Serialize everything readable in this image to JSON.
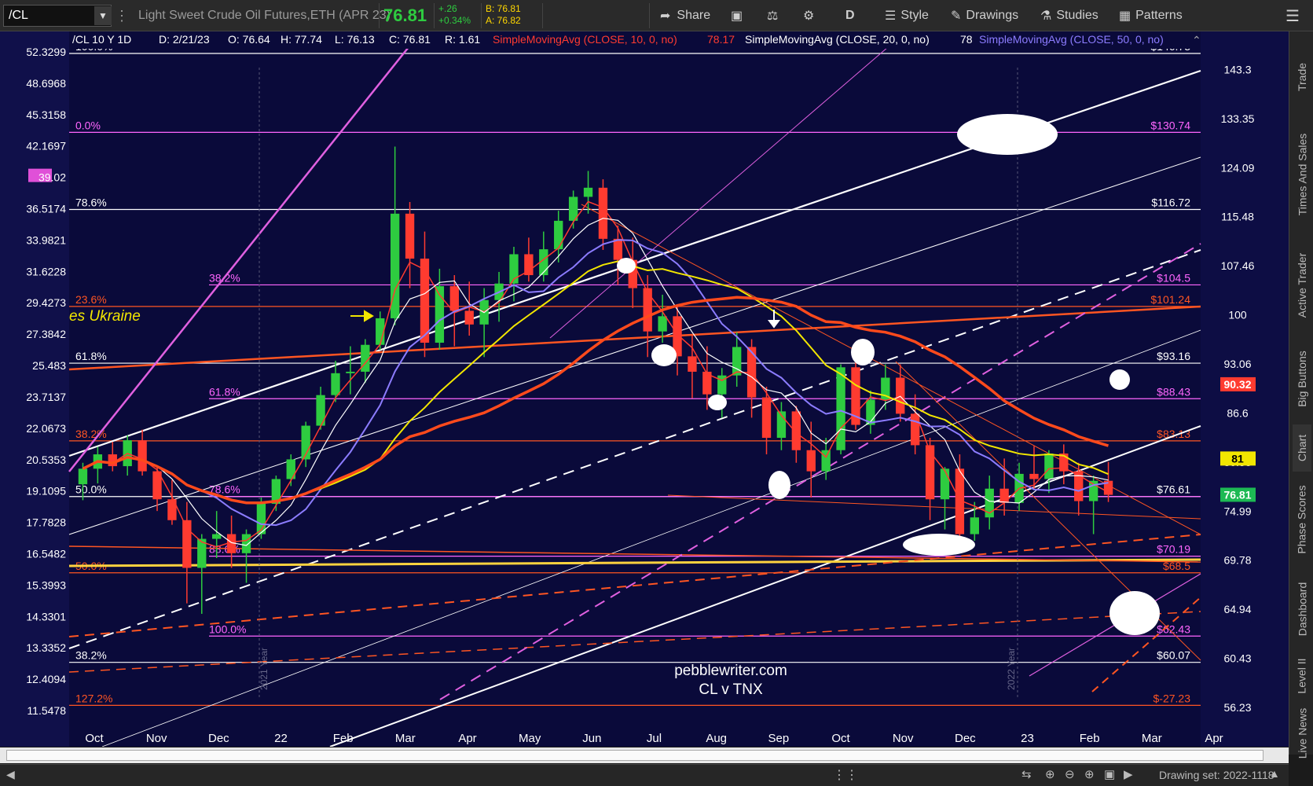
{
  "toolbar": {
    "symbol": "/CL",
    "description": "Light Sweet Crude Oil Futures,ETH (APR 23)",
    "last": "76.81",
    "change": "+.26",
    "change_pct": "+0.34%",
    "bid": "B: 76.81",
    "ask": "A: 76.82",
    "share": "Share",
    "period": "D",
    "style": "Style",
    "drawings": "Drawings",
    "studies": "Studies",
    "patterns": "Patterns"
  },
  "info_bar": {
    "title": "/CL 10 Y 1D",
    "date": "D: 2/21/23",
    "open": "O: 76.64",
    "high": "H: 77.74",
    "low": "L: 76.13",
    "close": "C: 76.81",
    "range": "R: 1.61",
    "sma10": "SimpleMovingAvg (CLOSE, 10, 0, no)",
    "sma10_val": "78.17",
    "sma20": "SimpleMovingAvg (CLOSE, 20, 0, no)",
    "sma20_val": "78",
    "sma50": "SimpleMovingAvg (CLOSE, 50, 0, no)"
  },
  "right_tabs": [
    "Trade",
    "Times And Sales",
    "Active Trader",
    "Big Buttons",
    "Chart",
    "Phase Scores",
    "Dashboard",
    "Level II",
    "Live News"
  ],
  "bottom": {
    "drawing_set": "Drawing set: 2022-1118"
  },
  "chart_data": {
    "type": "candlestick",
    "x_labels": [
      "Oct",
      "Nov",
      "Dec",
      "22",
      "Feb",
      "Mar",
      "Apr",
      "May",
      "Jun",
      "Jul",
      "Aug",
      "Sep",
      "Oct",
      "Nov",
      "Dec",
      "23",
      "Feb",
      "Mar",
      "Apr"
    ],
    "right_axis_labels": [
      "143.3",
      "133.35",
      "124.09",
      "115.48",
      "107.46",
      "100",
      "93.06",
      "86.6",
      "80.58",
      "74.99",
      "69.78",
      "64.94",
      "60.43",
      "56.23"
    ],
    "left_axis_labels": [
      "52.3299",
      "48.6968",
      "45.3158",
      "42.1697",
      "39.02",
      "36.5174",
      "33.9821",
      "31.6228",
      "29.4273",
      "27.3842",
      "25.483",
      "23.7137",
      "22.0673",
      "20.5353",
      "19.1095",
      "17.7828",
      "16.5482",
      "15.3993",
      "14.3301",
      "13.3352",
      "12.4094",
      "11.5478"
    ],
    "ylim": [
      56.23,
      146.73
    ],
    "year_markers": [
      "2021 Year",
      "2022 Year"
    ],
    "price_badges": [
      {
        "label": "90.32",
        "value": 90.32,
        "color": "#ff3b30"
      },
      {
        "label": "81",
        "value": 81,
        "color": "#f2e600"
      },
      {
        "label": "76.81",
        "value": 76.81,
        "color": "#1db954"
      }
    ],
    "left_badge": {
      "label": "39.02",
      "color": "#e050d8"
    },
    "levels": [
      {
        "left": "100.0%",
        "right": "$146.73",
        "y": 146.73,
        "color": "#ffffff"
      },
      {
        "left": "0.0%",
        "right": "$130.74",
        "y": 130.7,
        "color": "#ff66ff"
      },
      {
        "left": "78.6%",
        "right": "$116.72",
        "y": 116.72,
        "color": "#ffffff"
      },
      {
        "left": "38.2%",
        "right": "$104.5",
        "y": 104.5,
        "color": "#ff66ff"
      },
      {
        "left": "23.6%",
        "right": "$101.24",
        "y": 101.24,
        "color": "#ff5522"
      },
      {
        "left": "61.8%",
        "right": "$93.16",
        "y": 93.16,
        "color": "#ffffff"
      },
      {
        "left": "61.8%",
        "right": "$88.43",
        "y": 88.43,
        "color": "#ff66ff"
      },
      {
        "left": "38.2%",
        "right": "$83.13",
        "y": 83.13,
        "color": "#ff5522"
      },
      {
        "left": "50.0%",
        "right": "$76.61",
        "y": 76.61,
        "color": "#ffffff"
      },
      {
        "left": "78.6%",
        "right": "",
        "y": 76.61,
        "color": "#ff66ff"
      },
      {
        "left": "88.6%",
        "right": "$70.19",
        "y": 70.19,
        "color": "#ff66ff"
      },
      {
        "left": "50.0%",
        "right": "$68.5",
        "y": 68.5,
        "color": "#ff5522"
      },
      {
        "left": "100.0%",
        "right": "$62.43",
        "y": 62.43,
        "color": "#ff66ff"
      },
      {
        "left": "38.2%",
        "right": "$60.07",
        "y": 60.07,
        "color": "#ffffff"
      },
      {
        "left": "127.2%",
        "right": "$-27.23",
        "y": 56.4,
        "color": "#ff5522"
      }
    ],
    "annotation_ukraine": "es Ukraine",
    "watermark_line1": "pebblewriter.com",
    "watermark_line2": "CL v TNX",
    "candles": [
      [
        78.0,
        80.5,
        76.2,
        79.8
      ],
      [
        79.8,
        82.4,
        78.1,
        81.5
      ],
      [
        81.5,
        83.0,
        79.5,
        80.1
      ],
      [
        80.1,
        83.8,
        79.0,
        83.2
      ],
      [
        83.2,
        84.5,
        79.0,
        79.5
      ],
      [
        79.5,
        80.0,
        75.0,
        76.3
      ],
      [
        76.3,
        78.5,
        73.5,
        74.0
      ],
      [
        74.0,
        76.0,
        65.5,
        69.0
      ],
      [
        69.0,
        72.5,
        64.5,
        72.0
      ],
      [
        72.0,
        75.0,
        70.0,
        72.5
      ],
      [
        72.5,
        74.5,
        69.0,
        70.5
      ],
      [
        70.5,
        73.0,
        67.5,
        72.5
      ],
      [
        72.5,
        76.5,
        72.0,
        75.8
      ],
      [
        75.8,
        79.0,
        75.0,
        78.6
      ],
      [
        78.6,
        81.5,
        77.8,
        80.9
      ],
      [
        80.9,
        85.5,
        80.0,
        85.0
      ],
      [
        85.0,
        90.0,
        84.5,
        88.9
      ],
      [
        88.9,
        93.5,
        88.0,
        91.8
      ],
      [
        91.8,
        95.5,
        89.0,
        92.0
      ],
      [
        92.0,
        96.5,
        90.5,
        95.7
      ],
      [
        95.7,
        100.5,
        95.0,
        99.5
      ],
      [
        99.5,
        128.0,
        98.5,
        116.0
      ],
      [
        116.0,
        118.0,
        104.0,
        108.6
      ],
      [
        108.6,
        113.0,
        94.0,
        96.0
      ],
      [
        96.0,
        107.0,
        95.0,
        104.3
      ],
      [
        104.3,
        106.0,
        95.5,
        100.6
      ],
      [
        100.6,
        105.0,
        97.0,
        98.6
      ],
      [
        98.6,
        104.0,
        94.0,
        102.2
      ],
      [
        102.2,
        106.5,
        99.0,
        104.7
      ],
      [
        104.7,
        110.5,
        102.0,
        109.3
      ],
      [
        109.3,
        112.0,
        105.0,
        106.0
      ],
      [
        106.0,
        113.0,
        105.0,
        110.1
      ],
      [
        110.1,
        116.5,
        108.0,
        114.8
      ],
      [
        114.8,
        120.0,
        113.5,
        118.9
      ],
      [
        118.9,
        123.5,
        116.0,
        120.5
      ],
      [
        120.5,
        122.0,
        110.0,
        111.8
      ],
      [
        111.8,
        114.0,
        104.5,
        108.4
      ],
      [
        108.4,
        112.0,
        101.0,
        104.0
      ],
      [
        104.0,
        106.0,
        94.0,
        97.6
      ],
      [
        97.6,
        103.0,
        96.0,
        99.8
      ],
      [
        99.8,
        101.5,
        91.5,
        94.1
      ],
      [
        94.1,
        97.0,
        88.5,
        92.0
      ],
      [
        92.0,
        95.5,
        87.0,
        89.0
      ],
      [
        89.0,
        92.5,
        86.0,
        91.5
      ],
      [
        91.5,
        97.5,
        90.0,
        95.4
      ],
      [
        95.4,
        96.5,
        86.0,
        88.6
      ],
      [
        88.6,
        90.0,
        81.5,
        83.5
      ],
      [
        83.5,
        88.0,
        82.0,
        86.8
      ],
      [
        86.8,
        87.5,
        80.5,
        82.0
      ],
      [
        82.0,
        85.5,
        76.5,
        79.5
      ],
      [
        79.5,
        83.5,
        78.5,
        82.0
      ],
      [
        82.0,
        93.0,
        81.5,
        92.6
      ],
      [
        92.6,
        93.5,
        84.5,
        85.1
      ],
      [
        85.1,
        89.5,
        84.0,
        88.3
      ],
      [
        88.3,
        93.0,
        87.0,
        91.2
      ],
      [
        91.2,
        93.0,
        85.5,
        86.5
      ],
      [
        86.5,
        89.0,
        81.5,
        82.6
      ],
      [
        82.6,
        83.5,
        74.0,
        76.3
      ],
      [
        76.3,
        80.0,
        73.0,
        79.8
      ],
      [
        79.8,
        81.5,
        71.5,
        72.5
      ],
      [
        72.5,
        76.0,
        71.8,
        74.3
      ],
      [
        74.3,
        79.0,
        73.0,
        77.5
      ],
      [
        77.5,
        81.0,
        74.5,
        75.9
      ],
      [
        75.9,
        80.5,
        75.0,
        79.2
      ],
      [
        79.2,
        82.5,
        77.5,
        78.6
      ],
      [
        78.6,
        82.0,
        77.0,
        81.6
      ],
      [
        81.6,
        82.7,
        78.0,
        79.5
      ],
      [
        79.5,
        80.5,
        74.5,
        76.1
      ],
      [
        76.1,
        79.0,
        72.5,
        78.4
      ],
      [
        78.4,
        80.6,
        76.0,
        76.8
      ]
    ]
  }
}
